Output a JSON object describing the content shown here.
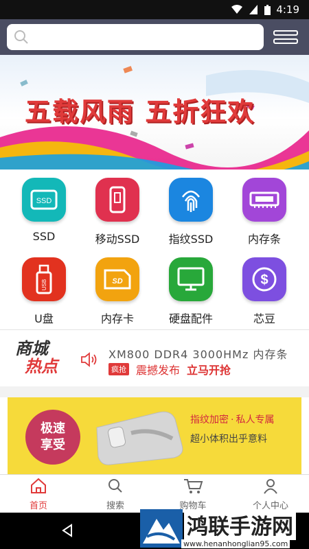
{
  "status": {
    "time": "4:19"
  },
  "search": {
    "placeholder": ""
  },
  "banner": {
    "title": "五载风雨  五折狂欢"
  },
  "categories": [
    {
      "label": "SSD",
      "icon": "ssd-icon",
      "color": "#13b8b8"
    },
    {
      "label": "移动SSD",
      "icon": "portable-ssd-icon",
      "color": "#e0314f"
    },
    {
      "label": "指纹SSD",
      "icon": "fingerprint-icon",
      "color": "#1b86e0"
    },
    {
      "label": "内存条",
      "icon": "memory-icon",
      "color": "#a246d8"
    },
    {
      "label": "U盘",
      "icon": "usb-drive-icon",
      "color": "#e2321f"
    },
    {
      "label": "内存卡",
      "icon": "sd-card-icon",
      "color": "#f2a30f"
    },
    {
      "label": "硬盘配件",
      "icon": "monitor-icon",
      "color": "#28a83a"
    },
    {
      "label": "芯豆",
      "icon": "dollar-coin-icon",
      "color": "#7d4fe0"
    }
  ],
  "hot": {
    "logo_line1": "商城",
    "logo_line2": "热点",
    "headline": "XM800 DDR4 3000HMz 内存条",
    "tag": "疯抢",
    "subline": "震撼发布",
    "cta": "立马开抢"
  },
  "promo": {
    "circle_line1": "极速",
    "circle_line2": "享受",
    "right_line1a": "指纹加密",
    "right_sep": "·",
    "right_line1b": "私人专属",
    "right_line2": "超小体积出乎意料"
  },
  "tabs": [
    {
      "label": "首页",
      "icon": "home-icon",
      "active": true
    },
    {
      "label": "搜索",
      "icon": "search-icon",
      "active": false
    },
    {
      "label": "购物车",
      "icon": "cart-icon",
      "active": false
    },
    {
      "label": "个人中心",
      "icon": "user-icon",
      "active": false
    }
  ],
  "watermark": {
    "name": "鸿联手游网",
    "url": "www.henanhonglian95.com"
  },
  "colors": {
    "accent": "#e03a3a",
    "topbar": "#4a4d62",
    "promo_bg": "#f6da3a"
  }
}
